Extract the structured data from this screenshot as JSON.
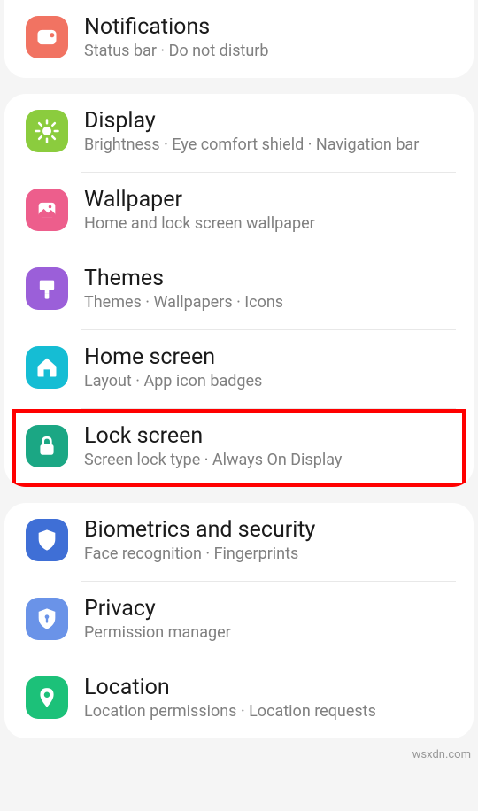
{
  "sections": [
    {
      "items": [
        {
          "key": "notifications",
          "title": "Notifications",
          "sub": "Status bar  ·  Do not disturb",
          "color": "#f17362",
          "icon": "notification"
        }
      ]
    },
    {
      "items": [
        {
          "key": "display",
          "title": "Display",
          "sub": "Brightness  ·  Eye comfort shield  ·  Navigation bar",
          "color": "#8bcc3e",
          "icon": "sun"
        },
        {
          "key": "wallpaper",
          "title": "Wallpaper",
          "sub": "Home and lock screen wallpaper",
          "color": "#ed5e8c",
          "icon": "picture"
        },
        {
          "key": "themes",
          "title": "Themes",
          "sub": "Themes  ·  Wallpapers  ·  Icons",
          "color": "#9b5fd9",
          "icon": "brush"
        },
        {
          "key": "home-screen",
          "title": "Home screen",
          "sub": "Layout  ·  App icon badges",
          "color": "#15bdd4",
          "icon": "home"
        },
        {
          "key": "lock-screen",
          "title": "Lock screen",
          "sub": "Screen lock type  ·  Always On Display",
          "color": "#1ba784",
          "icon": "lock",
          "highlight": true
        }
      ]
    },
    {
      "items": [
        {
          "key": "biometrics",
          "title": "Biometrics and security",
          "sub": "Face recognition  ·  Fingerprints",
          "color": "#3f6fd6",
          "icon": "shield"
        },
        {
          "key": "privacy",
          "title": "Privacy",
          "sub": "Permission manager",
          "color": "#6a93e8",
          "icon": "privacy"
        },
        {
          "key": "location",
          "title": "Location",
          "sub": "Location permissions  ·  Location requests",
          "color": "#1cc179",
          "icon": "pin"
        }
      ]
    }
  ],
  "watermark": "wsxdn.com"
}
